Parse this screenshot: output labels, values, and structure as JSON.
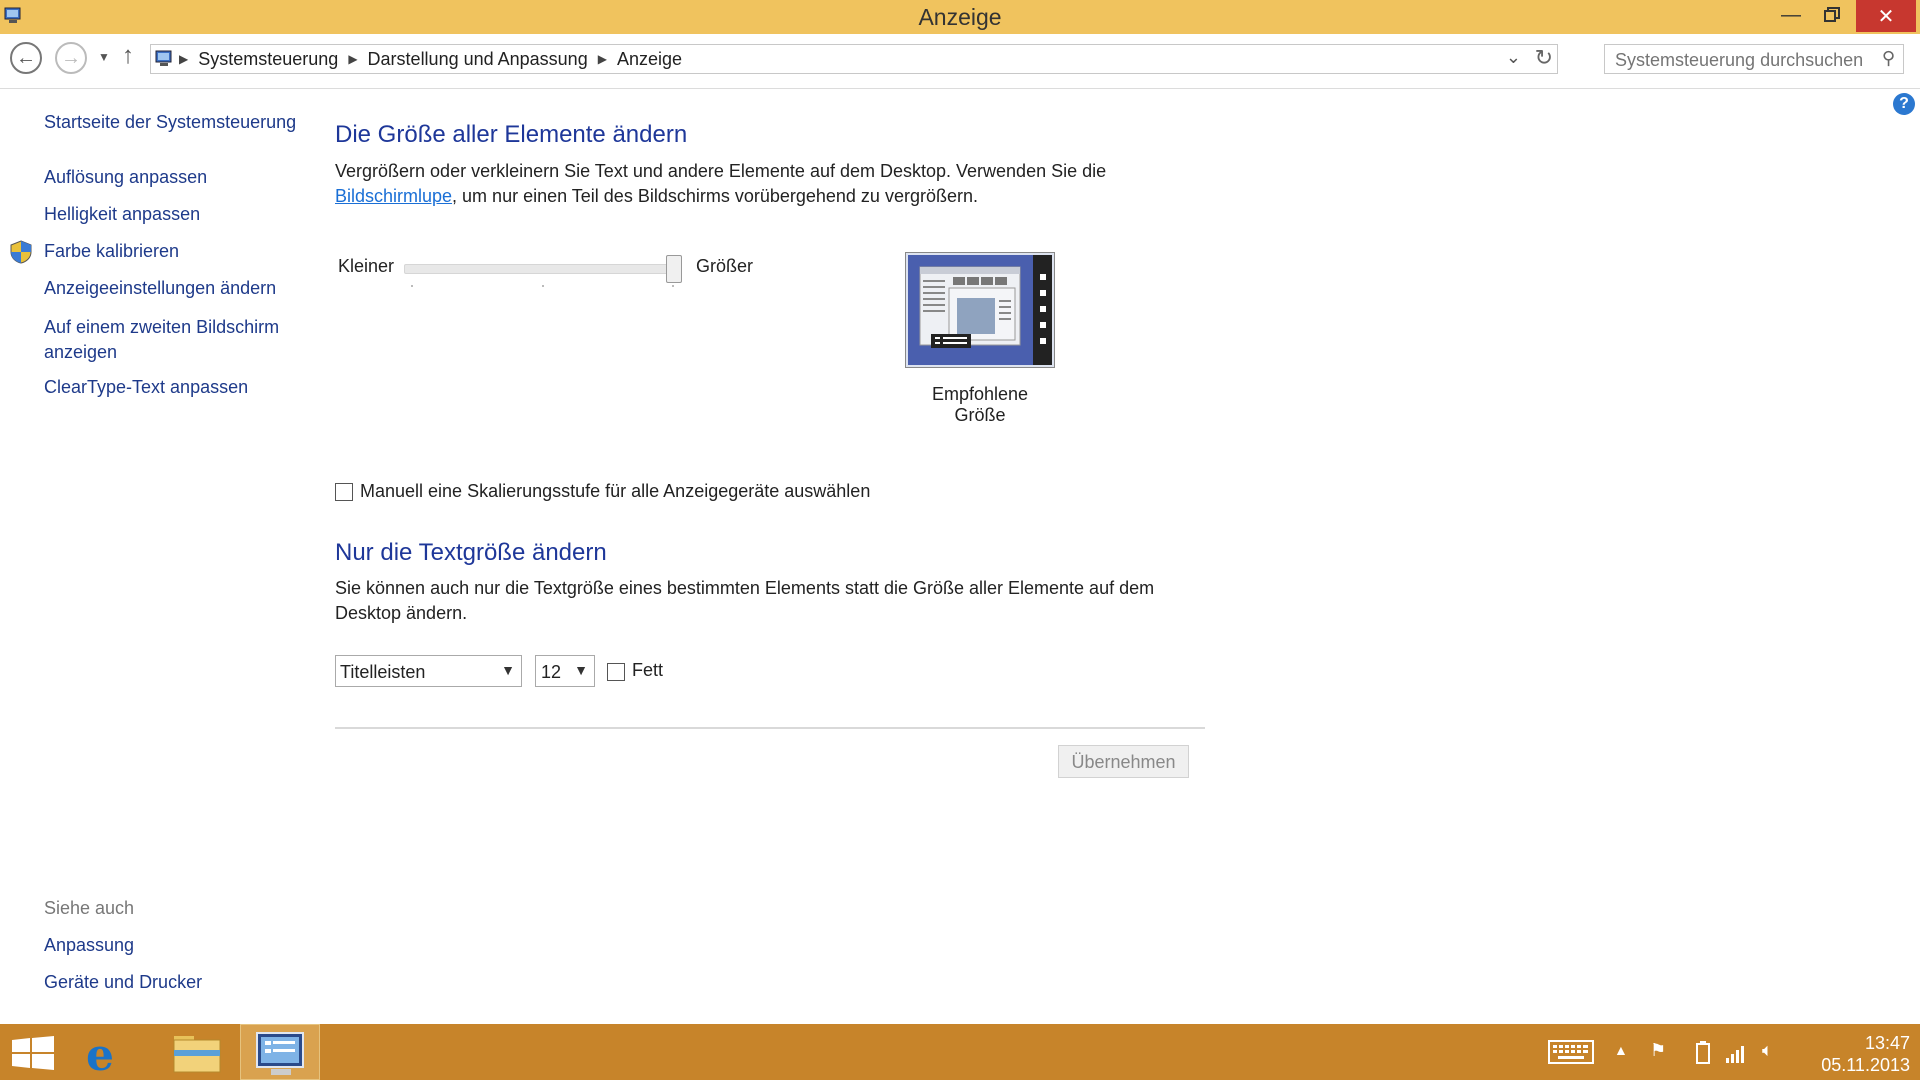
{
  "window": {
    "title": "Anzeige"
  },
  "navbar": {
    "breadcrumbs": [
      "Systemsteuerung",
      "Darstellung und Anpassung",
      "Anzeige"
    ],
    "search_placeholder": "Systemsteuerung durchsuchen"
  },
  "sidebar": {
    "home": "Startseite der Systemsteuerung",
    "items": [
      {
        "label": "Auflösung anpassen"
      },
      {
        "label": "Helligkeit anpassen"
      },
      {
        "label": "Farbe kalibrieren"
      },
      {
        "label": "Anzeigeeinstellungen ändern"
      },
      {
        "label": "Auf einem zweiten Bildschirm anzeigen"
      },
      {
        "label": "ClearType-Text anpassen"
      }
    ],
    "see_also_title": "Siehe auch",
    "see_also": [
      {
        "label": "Anpassung"
      },
      {
        "label": "Geräte und Drucker"
      }
    ]
  },
  "main": {
    "size_heading": "Die Größe aller Elemente ändern",
    "size_text_1": "Vergrößern oder verkleinern Sie Text und andere Elemente auf dem Desktop. Verwenden Sie die",
    "size_link": "Bildschirmlupe",
    "size_text_2": ", um nur einen Teil des Bildschirms vorübergehend zu vergrößern.",
    "slider_min_label": "Kleiner",
    "slider_max_label": "Größer",
    "slider_value_fraction": 1.0,
    "preview_label": "Empfohlene Größe",
    "manual_label": "Manuell eine Skalierungsstufe für alle Anzeigegeräte auswählen",
    "manual_checked": false,
    "text_heading": "Nur die Textgröße ändern",
    "text_para_1": "Sie können auch nur die Textgröße eines bestimmten Elements statt die Größe aller Elemente auf dem",
    "text_para_2": "Desktop ändern.",
    "element_select": "Titelleisten",
    "size_select": "12",
    "bold_label": "Fett",
    "bold_checked": false,
    "apply_label": "Übernehmen"
  },
  "taskbar": {
    "time": "13:47",
    "date": "05.11.2013"
  },
  "colors": {
    "titlebar": "#f0c35e",
    "taskbar": "#c7842a",
    "heading": "#1e3799",
    "link": "#1e3a8a",
    "close_button": "#c7372f"
  },
  "icons": [
    "back-arrow-icon",
    "forward-arrow-icon",
    "up-arrow-icon",
    "control-panel-icon",
    "search-icon",
    "refresh-icon",
    "help-icon",
    "shield-icon",
    "windows-start-icon",
    "internet-explorer-icon",
    "file-explorer-icon",
    "keyboard-icon",
    "flag-icon",
    "battery-icon",
    "network-icon",
    "speaker-icon"
  ]
}
